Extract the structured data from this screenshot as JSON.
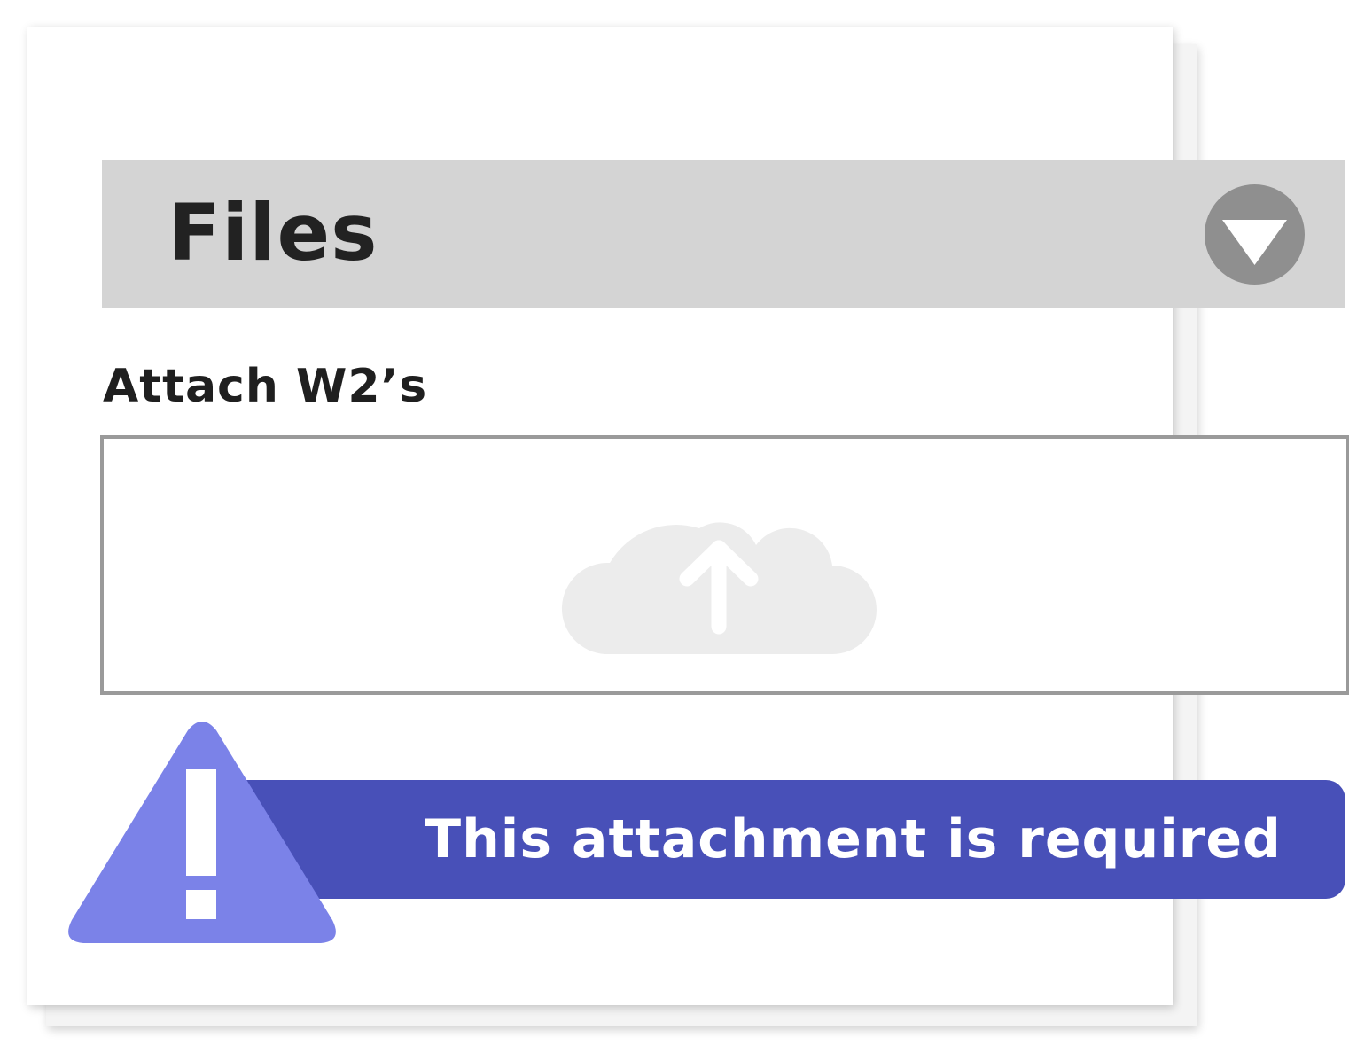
{
  "files_section": {
    "title": "Files",
    "toggle_icon": "chevron-down-icon"
  },
  "upload": {
    "label": "Attach W2’s",
    "icon": "cloud-upload-icon"
  },
  "validation": {
    "message": "This attachment is required",
    "icon": "warning-icon"
  },
  "colors": {
    "header_bar": "#d4d4d4",
    "toggle": "#8f8f8f",
    "banner": "#4850b8",
    "warning_triangle": "#7b82e8",
    "cloud": "#ececec"
  }
}
